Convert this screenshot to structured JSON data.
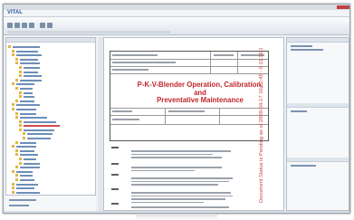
{
  "app": {
    "logo_text": "VITAL"
  },
  "document": {
    "title_line1": "P-K-V-Blender Operation, Calibration, and",
    "title_line2": "Preventative Maintenance",
    "watermark": "Document Status is Pending as of 2009-04-17 10:52:45 - 0:11:16 1"
  },
  "colors": {
    "title": "#c0262b",
    "watermark": "#d24040",
    "tree_link": "#6d8fb8",
    "tree_selected": "#d24a4a"
  }
}
